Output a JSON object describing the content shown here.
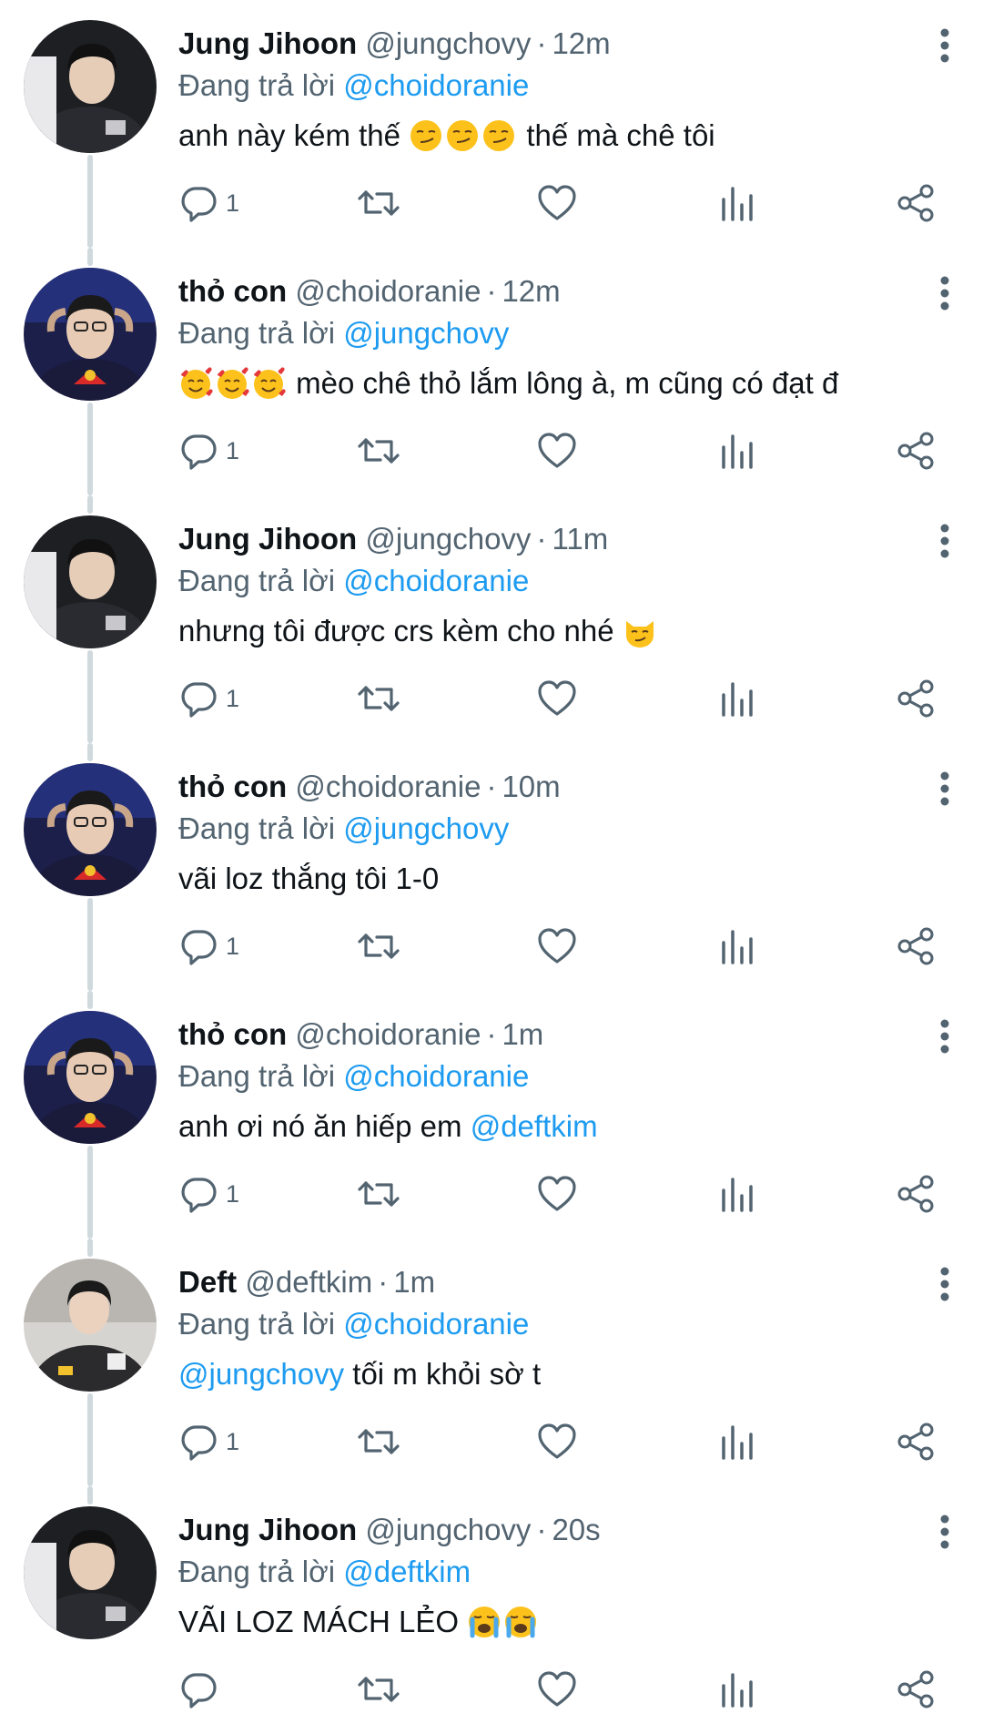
{
  "reply_prefix": "Đang trả lời",
  "tweets": [
    {
      "name": "Jung Jihoon",
      "handle": "@jungchovy",
      "time": "12m",
      "replying_to": "@choidoranie",
      "text_before": "anh này kém thế",
      "emoji": [
        "smirk-emoji",
        "smirk-emoji",
        "smirk-emoji"
      ],
      "text_after": "thế mà chê tôi",
      "reply_count": "1",
      "avatar": "avatar-jungchovy"
    },
    {
      "name": "thỏ con",
      "handle": "@choidoranie",
      "time": "12m",
      "replying_to": "@jungchovy",
      "text_before": "",
      "emoji": [
        "smiling-face-with-hearts-emoji",
        "smiling-face-with-hearts-emoji",
        "smiling-face-with-hearts-emoji"
      ],
      "text_after": "mèo chê thỏ lắm lông à, m cũng có đạt đ",
      "reply_count": "1",
      "avatar": "avatar-choidoranie"
    },
    {
      "name": "Jung Jihoon",
      "handle": "@jungchovy",
      "time": "11m",
      "replying_to": "@choidoranie",
      "text_before": "nhưng tôi được crs kèm cho nhé",
      "emoji": [
        "smirking-cat-emoji"
      ],
      "text_after": "",
      "reply_count": "1",
      "avatar": "avatar-jungchovy"
    },
    {
      "name": "thỏ con",
      "handle": "@choidoranie",
      "time": "10m",
      "replying_to": "@jungchovy",
      "text_before": "vãi loz thắng tôi 1-0",
      "emoji": [],
      "text_after": "",
      "reply_count": "1",
      "avatar": "avatar-choidoranie"
    },
    {
      "name": "thỏ con",
      "handle": "@choidoranie",
      "time": "1m",
      "replying_to": "@choidoranie",
      "text_before": "anh ơi nó ăn hiếp em",
      "emoji": [],
      "text_after": "",
      "text_mention": "@deftkim",
      "reply_count": "1",
      "avatar": "avatar-choidoranie"
    },
    {
      "name": "Deft",
      "handle": "@deftkim",
      "time": "1m",
      "replying_to": "@choidoranie",
      "text_mention_lead": "@jungchovy",
      "text_before": "tối m khỏi sờ t",
      "emoji": [],
      "text_after": "",
      "reply_count": "1",
      "avatar": "avatar-deftkim"
    },
    {
      "name": "Jung Jihoon",
      "handle": "@jungchovy",
      "time": "20s",
      "replying_to": "@deftkim",
      "text_before": "VÃI LOZ MÁCH LẺO",
      "emoji": [
        "loudly-crying-face-emoji",
        "loudly-crying-face-emoji"
      ],
      "text_after": "",
      "reply_count": "",
      "avatar": "avatar-jungchovy"
    }
  ],
  "colors": {
    "text": "#0f1419",
    "secondary": "#536471",
    "link": "#1d9bf0",
    "thread_line": "#cfd9de"
  },
  "icons": [
    "reply-icon",
    "retweet-icon",
    "like-icon",
    "views-icon",
    "share-icon",
    "more-icon"
  ]
}
